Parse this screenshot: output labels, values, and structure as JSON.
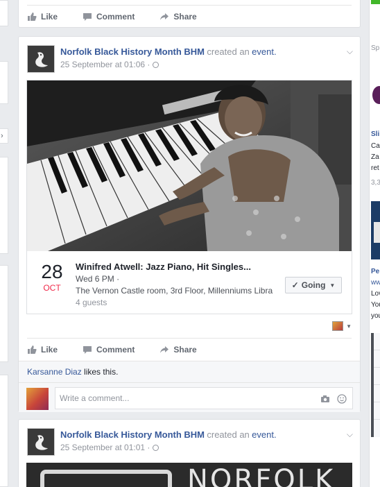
{
  "actions": {
    "like": "Like",
    "comment": "Comment",
    "share": "Share"
  },
  "post1": {
    "author": "Norfolk Black History Month BHM",
    "verb": "created an",
    "object": "event.",
    "time": "25 September at 01:06 ·",
    "event": {
      "day": "28",
      "month": "OCT",
      "title": "Winifred Atwell: Jazz Piano, Hit Singles...",
      "when": "Wed 6 PM ·",
      "where": "The Vernon Castle room, 3rd Floor, Millenniums Libra",
      "guests": "4 guests",
      "rsvp": "Going"
    },
    "liker": "Karsanne Diaz",
    "likes_suffix": " likes this.",
    "comment_placeholder": "Write a comment..."
  },
  "post2": {
    "author": "Norfolk Black History Month BHM",
    "verb": "created an",
    "object": "event.",
    "time": "25 September at 01:01 ·",
    "banner_text": "NORFOLK"
  },
  "right": {
    "heading": "Sp",
    "item1_title": "Sli",
    "item1_lines": [
      "Ca",
      "Za",
      "ret"
    ],
    "item1_count": "3,3",
    "item2_title": "Pe",
    "item2_url": "ww",
    "item2_lines": [
      "Lov",
      "You",
      "you"
    ]
  },
  "colors": {
    "link": "#365899",
    "month": "#f02849",
    "bg": "#e9ebee"
  }
}
